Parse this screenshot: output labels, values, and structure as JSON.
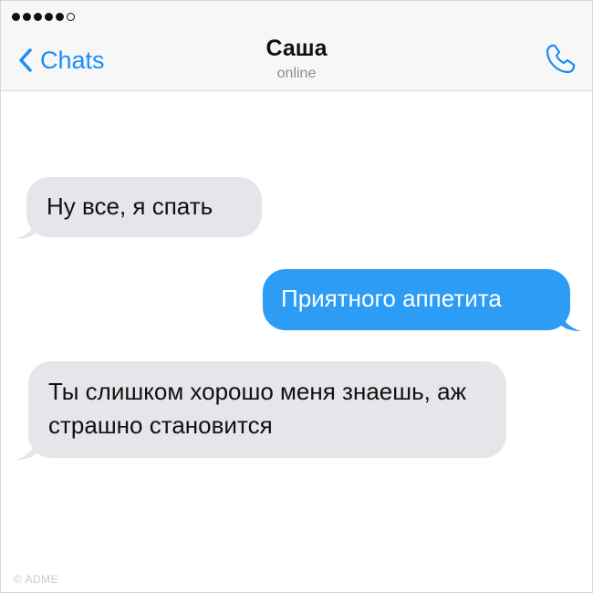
{
  "status_bar": {
    "signal_bars_filled": 5,
    "signal_bars_total": 6
  },
  "header": {
    "back_label": "Chats",
    "contact_name": "Саша",
    "contact_status": "online",
    "accent_color": "#1a8ef5"
  },
  "messages": [
    {
      "direction": "incoming",
      "text": "Ну все, я спать"
    },
    {
      "direction": "outgoing",
      "text": "Приятного аппетита"
    },
    {
      "direction": "incoming",
      "text": "Ты слишком хорошо меня знаешь, аж страшно становится"
    }
  ],
  "colors": {
    "incoming_bubble": "#e5e5ea",
    "outgoing_bubble": "#2d9cf4"
  },
  "watermark": "© ADME"
}
